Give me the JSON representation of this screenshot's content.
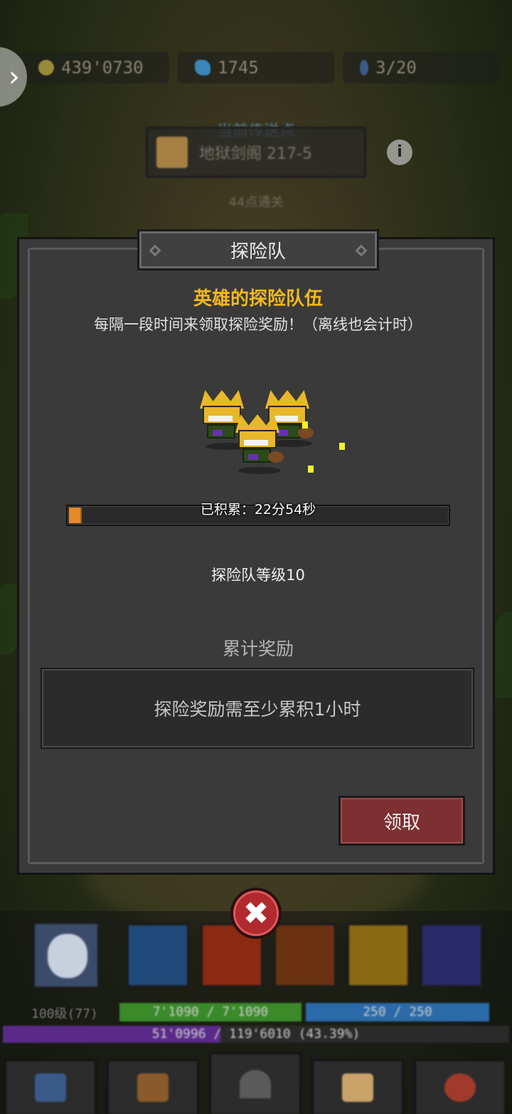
{
  "top_bar": {
    "gold": "439'0730",
    "gems": "1745",
    "keys": "3/20"
  },
  "teleport": {
    "title": "当前传送点",
    "location": "地狱剑阁 217-5",
    "pass_text": "44点通关"
  },
  "modal": {
    "title": "探险队",
    "heading": "英雄的探险队伍",
    "subtitle": "每隔一段时间来领取探险奖励！（离线也会计时）",
    "progress_label": "已积累：22分54秒",
    "progress_fraction": 0.034,
    "level_text": "探险队等级10",
    "rewards_title": "累计奖励",
    "rewards_message": "探险奖励需至少累积1小时",
    "claim_label": "领取"
  },
  "hud": {
    "level_text": "100级(77)",
    "hp_text": "7'1090 / 7'1090",
    "mp_text": "250 / 250",
    "exp_text": "51'0996 / 119'6010 (43.39%)"
  },
  "colors": {
    "accent_gold": "#f2b91c",
    "progress_orange": "#e38a2a",
    "claim_red": "#7d2f31",
    "close_red": "#b02a2e"
  },
  "icons": [
    "chevron-right-icon",
    "coin-icon",
    "gem-icon",
    "key-icon",
    "scroll-icon",
    "info-icon",
    "close-icon"
  ]
}
